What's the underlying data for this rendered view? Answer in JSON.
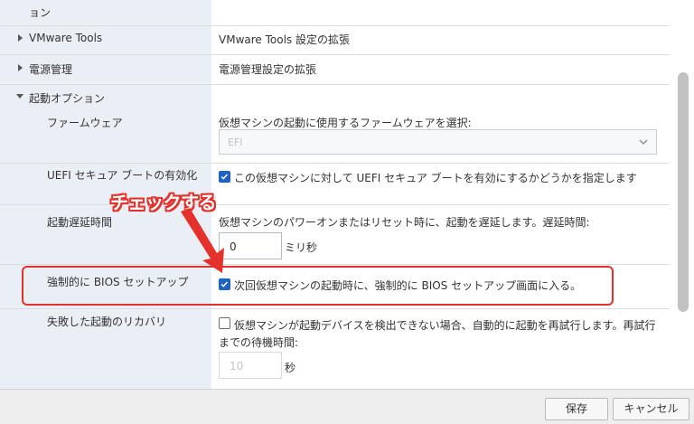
{
  "partial_row_label": "ョン",
  "rows": {
    "vmware_tools": {
      "label": "VMware Tools",
      "value": "VMware Tools 設定の拡張"
    },
    "power_management": {
      "label": "電源管理",
      "value": "電源管理設定の拡張"
    },
    "boot_options": {
      "label": "起動オプション"
    },
    "firmware": {
      "label": "ファームウェア",
      "description": "仮想マシンの起動に使用するファームウェアを選択:",
      "selected": "EFI"
    },
    "uefi_secure_boot": {
      "label": "UEFI セキュア ブートの有効化",
      "checkbox_text": "この仮想マシンに対して UEFI セキュア ブートを有効にするかどうかを指定します",
      "checked": true
    },
    "boot_delay": {
      "label": "起動遅延時間",
      "description": "仮想マシンのパワーオンまたはリセット時に、起動を遅延します。遅延時間:",
      "value": "0",
      "unit": "ミリ秒"
    },
    "force_bios_setup": {
      "label": "強制的に BIOS セットアップ",
      "checkbox_text": "次回仮想マシンの起動時に、強制的に BIOS セットアップ画面に入る。",
      "checked": true
    },
    "failed_boot_recovery": {
      "label": "失敗した起動のリカバリ",
      "checkbox_text_line1": "仮想マシンが起動デバイスを検出できない場合、自動的に起動を再試行します。再試行",
      "checkbox_text_line2": "までの待機時間:",
      "checked": false,
      "value": "10",
      "unit": "秒"
    }
  },
  "annotation": {
    "text": "チェックする",
    "color": "#e5312c"
  },
  "footer": {
    "save_label": "保存",
    "cancel_label": "キャンセル"
  },
  "colors": {
    "label_bg": "#e9eff5",
    "checkbox_blue": "#1e62c6"
  }
}
